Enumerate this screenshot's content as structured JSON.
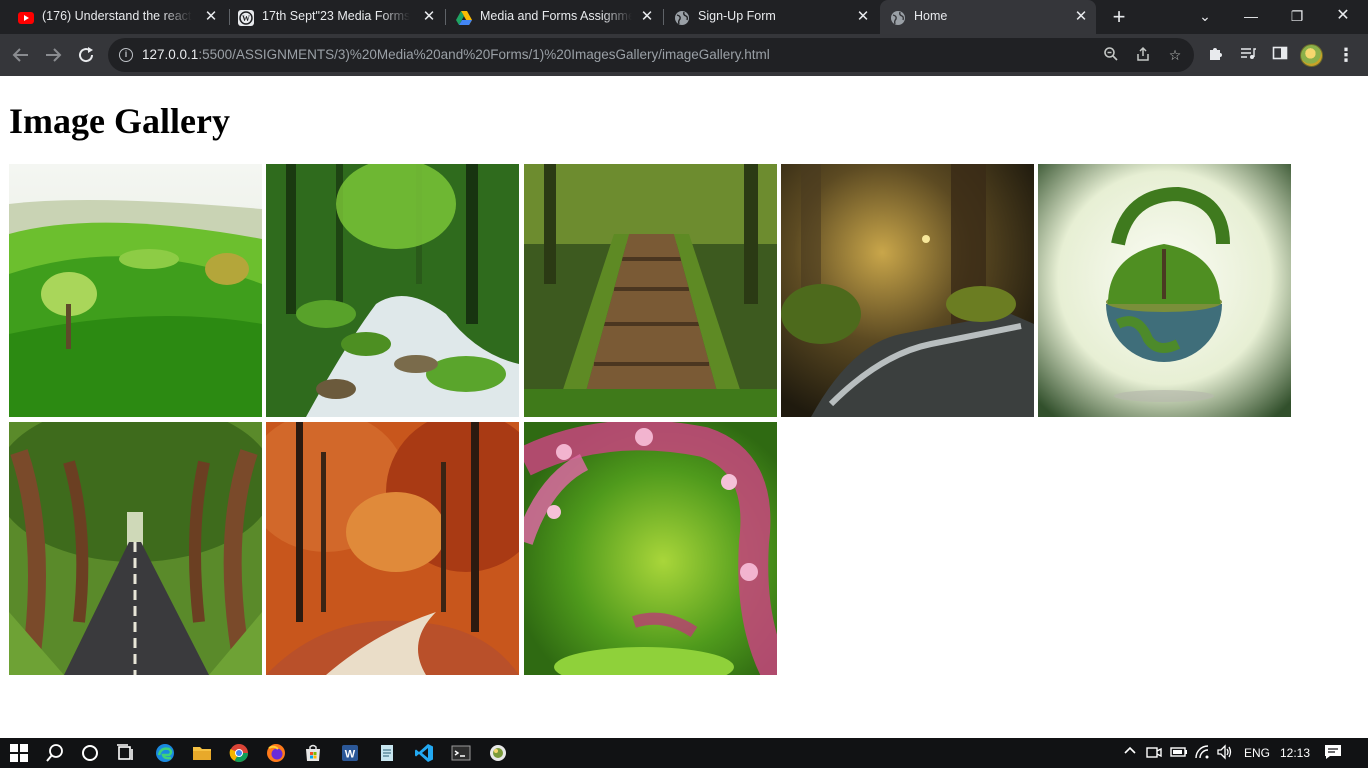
{
  "browser": {
    "tabs": [
      {
        "title": "(176) Understand the react f",
        "icon": "youtube-icon"
      },
      {
        "title": "17th Sept\"23 Media Forms, I",
        "icon": "wordpress-icon"
      },
      {
        "title": "Media and Forms Assignmen",
        "icon": "google-drive-icon"
      },
      {
        "title": "Sign-Up Form",
        "icon": "globe-icon"
      },
      {
        "title": "Home",
        "icon": "globe-icon",
        "active": true
      }
    ],
    "address": {
      "host": "127.0.0.1",
      "path": ":5500/ASSIGNMENTS/3)%20Media%20and%20Forms/1)%20ImagesGallery/imageGallery.html"
    }
  },
  "page": {
    "heading": "Image Gallery",
    "images": [
      {
        "name": "green-hills"
      },
      {
        "name": "forest-stream"
      },
      {
        "name": "mossy-bridge"
      },
      {
        "name": "forest-creek"
      },
      {
        "name": "green-globe"
      },
      {
        "name": "tree-lined-road"
      },
      {
        "name": "autumn-forest"
      },
      {
        "name": "pink-blossoms"
      }
    ]
  },
  "taskbar": {
    "language": "ENG",
    "time": "12:13"
  }
}
